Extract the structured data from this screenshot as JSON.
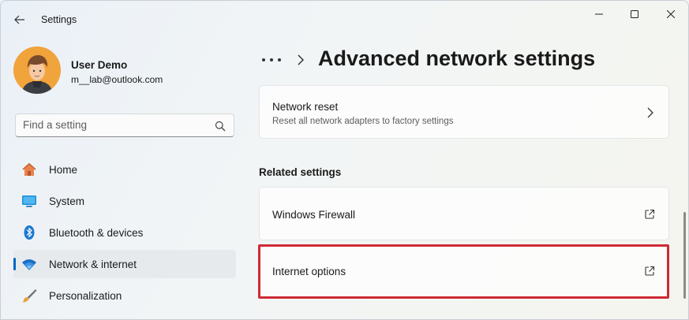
{
  "window": {
    "title": "Settings"
  },
  "user": {
    "name": "User Demo",
    "email": "m__lab@outlook.com"
  },
  "search": {
    "placeholder": "Find a setting"
  },
  "nav": {
    "items": [
      {
        "label": "Home",
        "icon": "home-icon"
      },
      {
        "label": "System",
        "icon": "system-icon"
      },
      {
        "label": "Bluetooth & devices",
        "icon": "bluetooth-icon"
      },
      {
        "label": "Network & internet",
        "icon": "wifi-icon",
        "active": true
      },
      {
        "label": "Personalization",
        "icon": "brush-icon"
      }
    ]
  },
  "breadcrumb": {
    "title": "Advanced network settings"
  },
  "cards": {
    "network_reset": {
      "title": "Network reset",
      "subtitle": "Reset all network adapters to factory settings"
    }
  },
  "related": {
    "heading": "Related settings",
    "items": [
      {
        "label": "Windows Firewall"
      },
      {
        "label": "Internet options"
      }
    ]
  },
  "colors": {
    "accent": "#0067c0",
    "highlight": "#cf2a35"
  }
}
